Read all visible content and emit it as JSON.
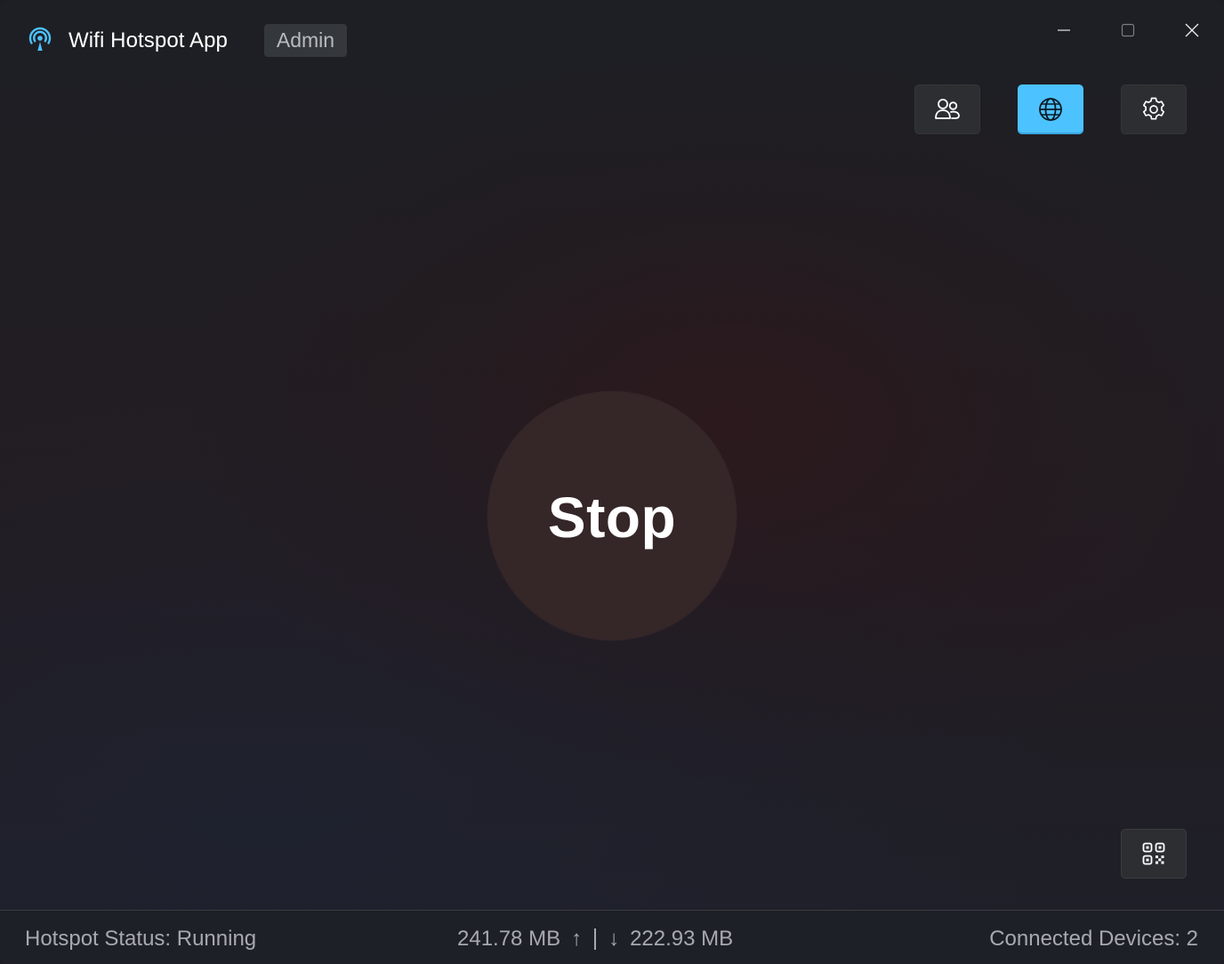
{
  "titlebar": {
    "app_title": "Wifi Hotspot App",
    "badge": "Admin",
    "app_icon": "hotspot-broadcast-icon",
    "controls": [
      "minimize-icon",
      "maximize-icon",
      "close-icon"
    ]
  },
  "toolbar": {
    "buttons": [
      {
        "icon": "users-icon",
        "active": false
      },
      {
        "icon": "globe-icon",
        "active": true
      },
      {
        "icon": "gear-icon",
        "active": false
      }
    ],
    "accent_color": "#4cc2ff"
  },
  "main": {
    "toggle_label": "Stop",
    "qr_icon": "qr-code-icon"
  },
  "statusbar": {
    "status": "Hotspot Status: Running",
    "upload": "241.78 MB",
    "upload_arrow": "↑",
    "download_arrow": "↓",
    "download": "222.93 MB",
    "devices": "Connected Devices: 2"
  }
}
